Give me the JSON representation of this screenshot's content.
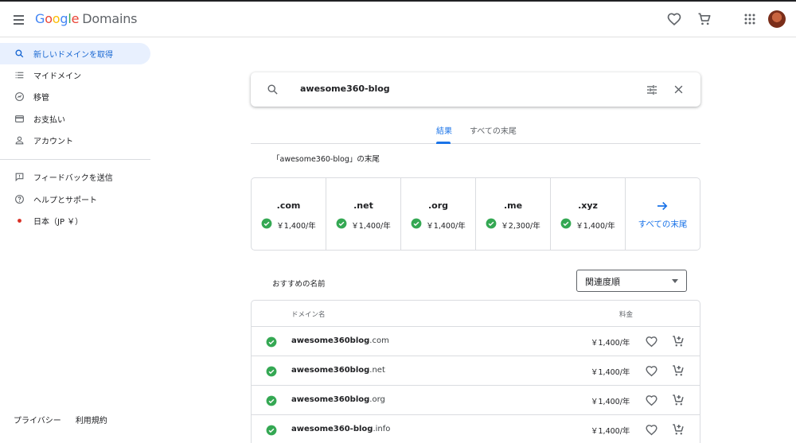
{
  "header": {
    "logo_google": [
      "G",
      "o",
      "o",
      "g",
      "l",
      "e"
    ],
    "logo_product": "Domains",
    "icons": [
      "menu-icon",
      "heart-icon",
      "cart-icon",
      "apps-icon",
      "avatar"
    ]
  },
  "sidebar": {
    "items": [
      {
        "label": "新しいドメインを取得",
        "icon": "search-icon",
        "active": true
      },
      {
        "label": "マイドメイン",
        "icon": "list-icon"
      },
      {
        "label": "移管",
        "icon": "transfer-icon"
      },
      {
        "label": "お支払い",
        "icon": "credit-card-icon"
      },
      {
        "label": "アカウント",
        "icon": "person-icon"
      },
      {
        "label": "フィードバックを送信",
        "icon": "feedback-icon"
      },
      {
        "label": "ヘルプとサポート",
        "icon": "help-icon"
      },
      {
        "label": "日本（JP ￥）",
        "icon": "japan-flag-dot-icon"
      }
    ],
    "footer": [
      "プライバシー",
      "利用規約"
    ]
  },
  "search": {
    "value": "awesome360-blog"
  },
  "tabs": [
    {
      "label": "結果",
      "active": true
    },
    {
      "label": "すべての末尾",
      "active": false
    }
  ],
  "tld_section": {
    "heading": "「awesome360-blog」の末尾",
    "items": [
      {
        "tld": ".com",
        "price": "￥1,400/年"
      },
      {
        "tld": ".net",
        "price": "￥1,400/年"
      },
      {
        "tld": ".org",
        "price": "￥1,400/年"
      },
      {
        "tld": ".me",
        "price": "￥2,300/年"
      },
      {
        "tld": ".xyz",
        "price": "￥1,400/年"
      }
    ],
    "all_label": "すべての末尾"
  },
  "recommended": {
    "label": "おすすめの名前",
    "sort_value": "関連度順",
    "col_name": "ドメイン名",
    "col_price": "料金",
    "rows": [
      {
        "base": "awesome360blog",
        "tld": ".com",
        "price": "￥1,400/年"
      },
      {
        "base": "awesome360blog",
        "tld": ".net",
        "price": "￥1,400/年"
      },
      {
        "base": "awesome360blog",
        "tld": ".org",
        "price": "￥1,400/年"
      },
      {
        "base": "awesome360-blog",
        "tld": ".info",
        "price": "￥1,400/年"
      }
    ]
  },
  "colors": {
    "accent": "#1a73e8",
    "available_green": "#34a853",
    "active_bg": "#e8f0fe"
  }
}
